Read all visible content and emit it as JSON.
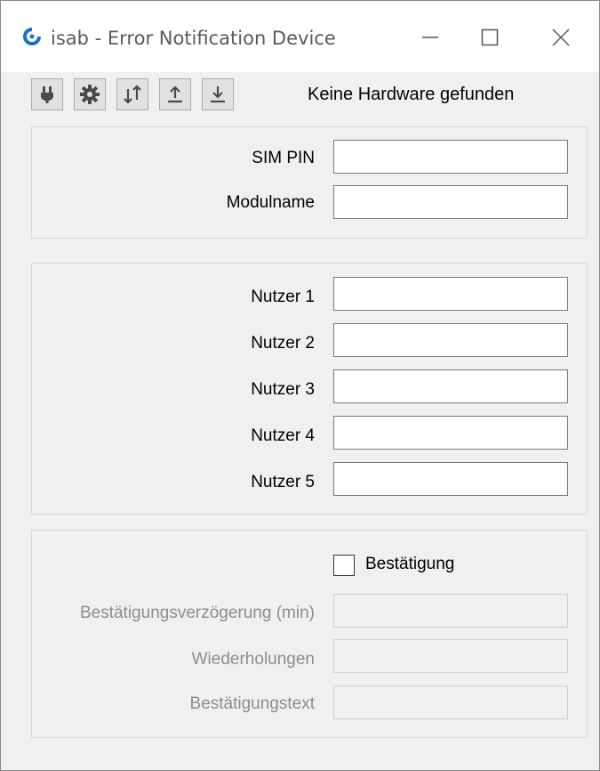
{
  "window": {
    "title": "isab - Error Notification Device",
    "controls": {
      "minimize": "minimize-icon",
      "maximize": "maximize-icon",
      "close": "close-icon"
    }
  },
  "toolbar": {
    "buttons": [
      {
        "icon": "plug-icon"
      },
      {
        "icon": "gear-icon"
      },
      {
        "icon": "transfer-icon"
      },
      {
        "icon": "upload-icon"
      },
      {
        "icon": "download-icon"
      }
    ],
    "status": "Keine Hardware gefunden"
  },
  "sim": {
    "pin_label": "SIM PIN",
    "pin_value": "",
    "module_label": "Modulname",
    "module_value": ""
  },
  "users": [
    {
      "label": "Nutzer 1",
      "value": ""
    },
    {
      "label": "Nutzer 2",
      "value": ""
    },
    {
      "label": "Nutzer 3",
      "value": ""
    },
    {
      "label": "Nutzer 4",
      "value": ""
    },
    {
      "label": "Nutzer 5",
      "value": ""
    }
  ],
  "confirmation": {
    "checkbox_label": "Bestätigung",
    "checked": false,
    "delay_label": "Bestätigungsverzögerung (min)",
    "delay_value": "",
    "repeats_label": "Wiederholungen",
    "repeats_value": "",
    "text_label": "Bestätigungstext",
    "text_value": ""
  },
  "colors": {
    "window_bg": "#f0f0f0",
    "titlebar_bg": "#ffffff",
    "icon_blue": "#1a73c8",
    "disabled_text": "#8d8d8d"
  }
}
